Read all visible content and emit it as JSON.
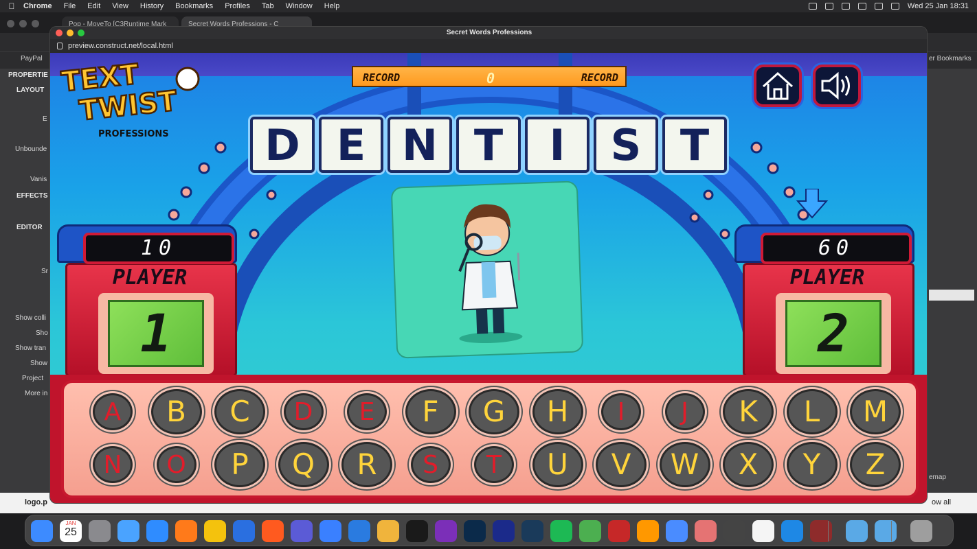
{
  "menubar": {
    "apple": "",
    "items": [
      "Chrome",
      "File",
      "Edit",
      "View",
      "History",
      "Bookmarks",
      "Profiles",
      "Tab",
      "Window",
      "Help"
    ],
    "datetime": "Wed 25 Jan  18:31"
  },
  "bg_chrome": {
    "tab1": "Pop - MoveTo [C3Runtime Mark",
    "tab2": "Secret Words Professions - C",
    "bookmark_paypal": "PayPal",
    "other_bookmarks": "er Bookmarks",
    "left_panel": {
      "properties": "PROPERTIE",
      "layout": "LAYOUT",
      "e": "E",
      "unbounded": "Unbounde",
      "vanis": "Vanis",
      "effects": "EFFECTS",
      "editor": "EDITOR",
      "sr": "Sr",
      "show_colli": "Show colli",
      "sho": "Sho",
      "show_tran": "Show tran",
      "show": "Show",
      "project": "Project",
      "more_in": "More in"
    },
    "right_panel": {
      "emap": "emap",
      "ow_all": "ow all"
    },
    "bottom_file": "logo.p"
  },
  "window": {
    "title": "Secret Words Professions",
    "url": "preview.construct.net/local.html"
  },
  "game": {
    "record_left": "RECORD",
    "record_value": "0",
    "record_right": "RECORD",
    "logo_line1": "TEXT",
    "logo_line2": "TWIST",
    "logo_sub": "PROFESSIONS",
    "word": [
      "D",
      "E",
      "N",
      "T",
      "I",
      "S",
      "T"
    ],
    "player1": {
      "score": "10",
      "label": "PLAYER",
      "number": "1"
    },
    "player2": {
      "score": "60",
      "label": "PLAYER",
      "number": "2"
    },
    "active_player": "2",
    "keys_row1": [
      {
        "letter": "A",
        "used": true
      },
      {
        "letter": "B",
        "used": false
      },
      {
        "letter": "C",
        "used": false
      },
      {
        "letter": "D",
        "used": true
      },
      {
        "letter": "E",
        "used": true
      },
      {
        "letter": "F",
        "used": false
      },
      {
        "letter": "G",
        "used": false
      },
      {
        "letter": "H",
        "used": false
      },
      {
        "letter": "I",
        "used": true
      },
      {
        "letter": "J",
        "used": true
      },
      {
        "letter": "K",
        "used": false
      },
      {
        "letter": "L",
        "used": false
      },
      {
        "letter": "M",
        "used": false
      }
    ],
    "keys_row2": [
      {
        "letter": "N",
        "used": true
      },
      {
        "letter": "O",
        "used": true
      },
      {
        "letter": "P",
        "used": false
      },
      {
        "letter": "Q",
        "used": false
      },
      {
        "letter": "R",
        "used": false
      },
      {
        "letter": "S",
        "used": true
      },
      {
        "letter": "T",
        "used": true
      },
      {
        "letter": "U",
        "used": false
      },
      {
        "letter": "V",
        "used": false
      },
      {
        "letter": "W",
        "used": false
      },
      {
        "letter": "X",
        "used": false
      },
      {
        "letter": "Y",
        "used": false
      },
      {
        "letter": "Z",
        "used": false
      }
    ],
    "colors": {
      "used_letter": "#e21c2a",
      "available_letter": "#ffd43b",
      "tile_text": "#13215a"
    }
  },
  "dock": {
    "calendar_month": "JAN",
    "calendar_day": "25"
  }
}
